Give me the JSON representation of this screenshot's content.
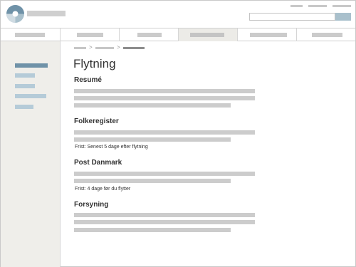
{
  "colors": {
    "accent": "#6f92a8",
    "accent_light": "#b5cbd8",
    "sidebar_bg": "#efeeea",
    "placeholder": "#cccccc"
  },
  "header": {
    "logo_icon": "logo-icon",
    "search_icon": "search-icon"
  },
  "main": {
    "title": "Flytning",
    "sections": [
      {
        "title": "Resumé",
        "note": ""
      },
      {
        "title": "Folkeregister",
        "note": "Frist: Senest 5 dage efter flytning"
      },
      {
        "title": "Post Danmark",
        "note": "Frist: 4 dage før du flytter"
      },
      {
        "title": "Forsyning",
        "note": ""
      }
    ]
  }
}
